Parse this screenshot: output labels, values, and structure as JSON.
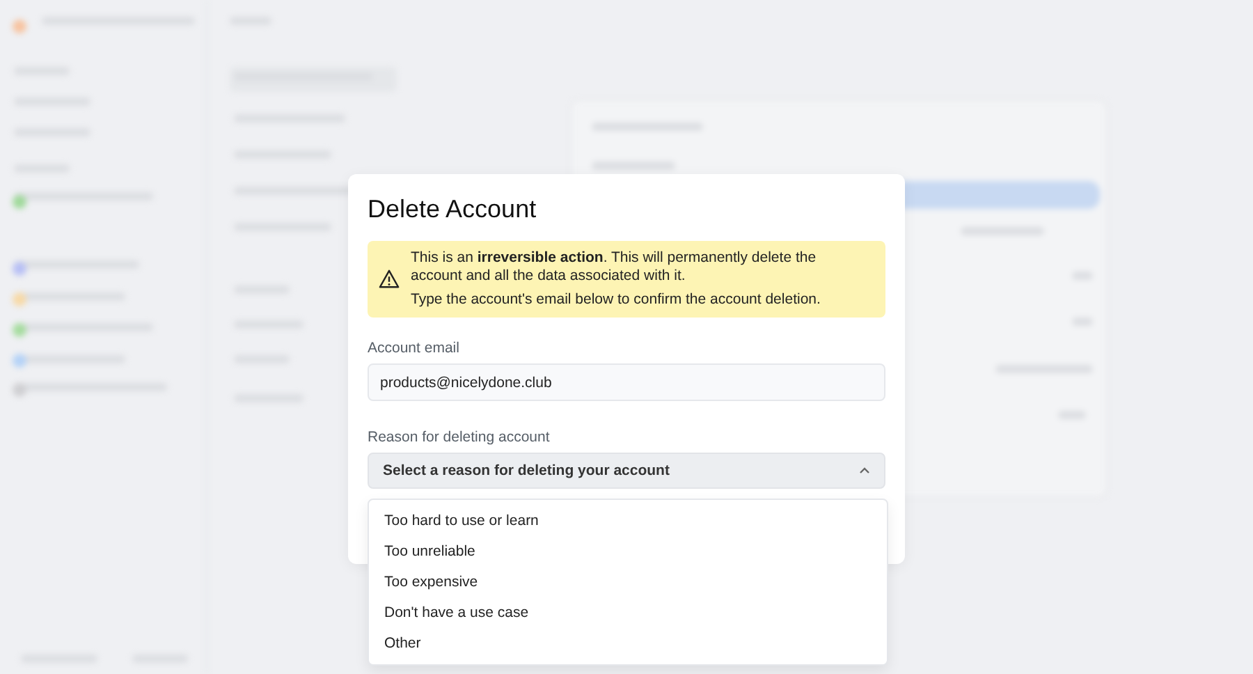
{
  "dialog": {
    "title": "Delete Account",
    "warning": [
      "This is an **irreversible action**. This will permanently delete the account and all the data associated with it.",
      "Type the account's email below to confirm the account deletion."
    ],
    "email_field": {
      "label": "Account email",
      "value": "products@nicelydone.club"
    },
    "reason_field": {
      "label": "Reason for deleting account",
      "placeholder": "Select a reason for deleting your account",
      "expanded": true,
      "options": [
        {
          "label": "Too hard to use or learn"
        },
        {
          "label": "Too unreliable"
        },
        {
          "label": "Too expensive"
        },
        {
          "label": "Don't have a use case"
        },
        {
          "label": "Other"
        }
      ]
    }
  }
}
